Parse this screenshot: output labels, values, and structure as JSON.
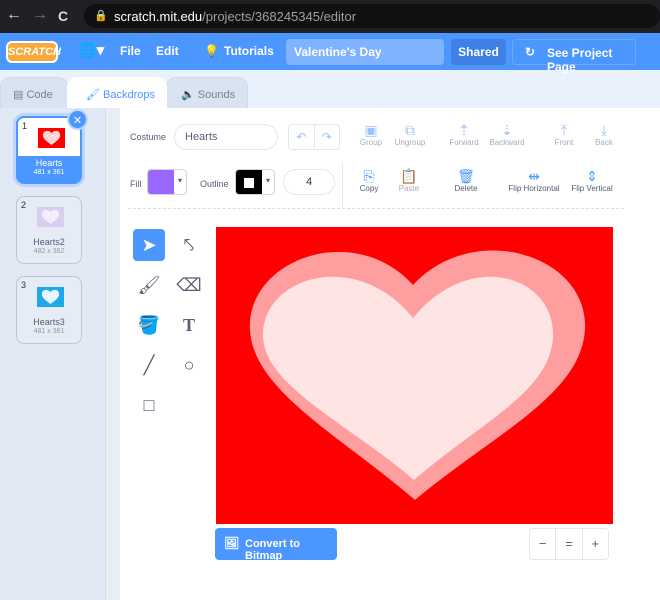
{
  "browser": {
    "back": "←",
    "forward": "→",
    "reload": "C",
    "url_host": "scratch.mit.edu",
    "url_path": "/projects/368245345/editor"
  },
  "menu": {
    "logo": "SCRATCH",
    "file": "File",
    "edit": "Edit",
    "tutorials": "Tutorials",
    "project_title": "Valentine's Day",
    "shared": "Shared",
    "see_project_page": "See Project Page"
  },
  "tabs": {
    "code": "Code",
    "backdrops": "Backdrops",
    "sounds": "Sounds"
  },
  "costumes": [
    {
      "num": "1",
      "name": "Hearts",
      "size": "481 x 361",
      "bg": "#ff0000",
      "heart": "#ffd6d6"
    },
    {
      "num": "2",
      "name": "Hearts2",
      "size": "482 x 362",
      "bg": "#d9cdf0",
      "heart": "#f4eefc"
    },
    {
      "num": "3",
      "name": "Hearts3",
      "size": "481 x 361",
      "bg": "#1fa8e8",
      "heart": "#e6f8ff"
    }
  ],
  "toolbar": {
    "costume_label": "Costume",
    "costume_name": "Hearts",
    "group": "Group",
    "ungroup": "Ungroup",
    "forward": "Forward",
    "backward": "Backward",
    "front": "Front",
    "back": "Back",
    "fill_label": "Fill",
    "fill_color": "#9966ff",
    "outline_label": "Outline",
    "outline_color": "#000000",
    "outline_width": "4",
    "copy": "Copy",
    "paste": "Paste",
    "delete": "Delete",
    "flip_h": "Flip Horizontal",
    "flip_v": "Flip Vertical"
  },
  "canvas": {
    "background": "#ff0000",
    "outer_heart": "#ff9e9e",
    "inner_heart": "#ffe4e4"
  },
  "footer": {
    "convert": "Convert to Bitmap",
    "zoom_out": "−",
    "zoom_reset": "=",
    "zoom_in": "+"
  }
}
